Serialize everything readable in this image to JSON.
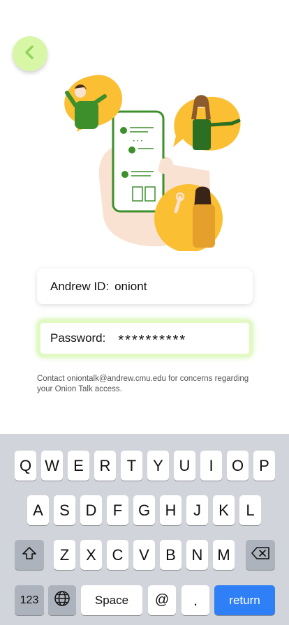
{
  "form": {
    "andrew_label": "Andrew ID:",
    "andrew_value": "oniont",
    "password_label": "Password:",
    "password_value": "**********"
  },
  "contact_text": "Contact oniontalk@andrew.cmu.edu for concerns regarding your Onion Talk access.",
  "keyboard": {
    "row1": [
      "Q",
      "W",
      "E",
      "R",
      "T",
      "Y",
      "U",
      "I",
      "O",
      "P"
    ],
    "row2": [
      "A",
      "S",
      "D",
      "F",
      "G",
      "H",
      "J",
      "K",
      "L"
    ],
    "row3": [
      "Z",
      "X",
      "C",
      "V",
      "B",
      "N",
      "M"
    ],
    "numbers_label": "123",
    "space_label": "Space",
    "at_label": "@",
    "period_label": ".",
    "return_label": "return"
  },
  "icons": {
    "back": "chevron-left-icon",
    "shift": "shift-icon",
    "delete": "backspace-icon",
    "globe": "globe-icon"
  },
  "colors": {
    "accent_green": "#d8f7a6",
    "illustration_yellow": "#fbbf33",
    "illustration_green": "#3c8f2a",
    "return_blue": "#2f80f6",
    "keyboard_bg": "#d1d4da"
  }
}
